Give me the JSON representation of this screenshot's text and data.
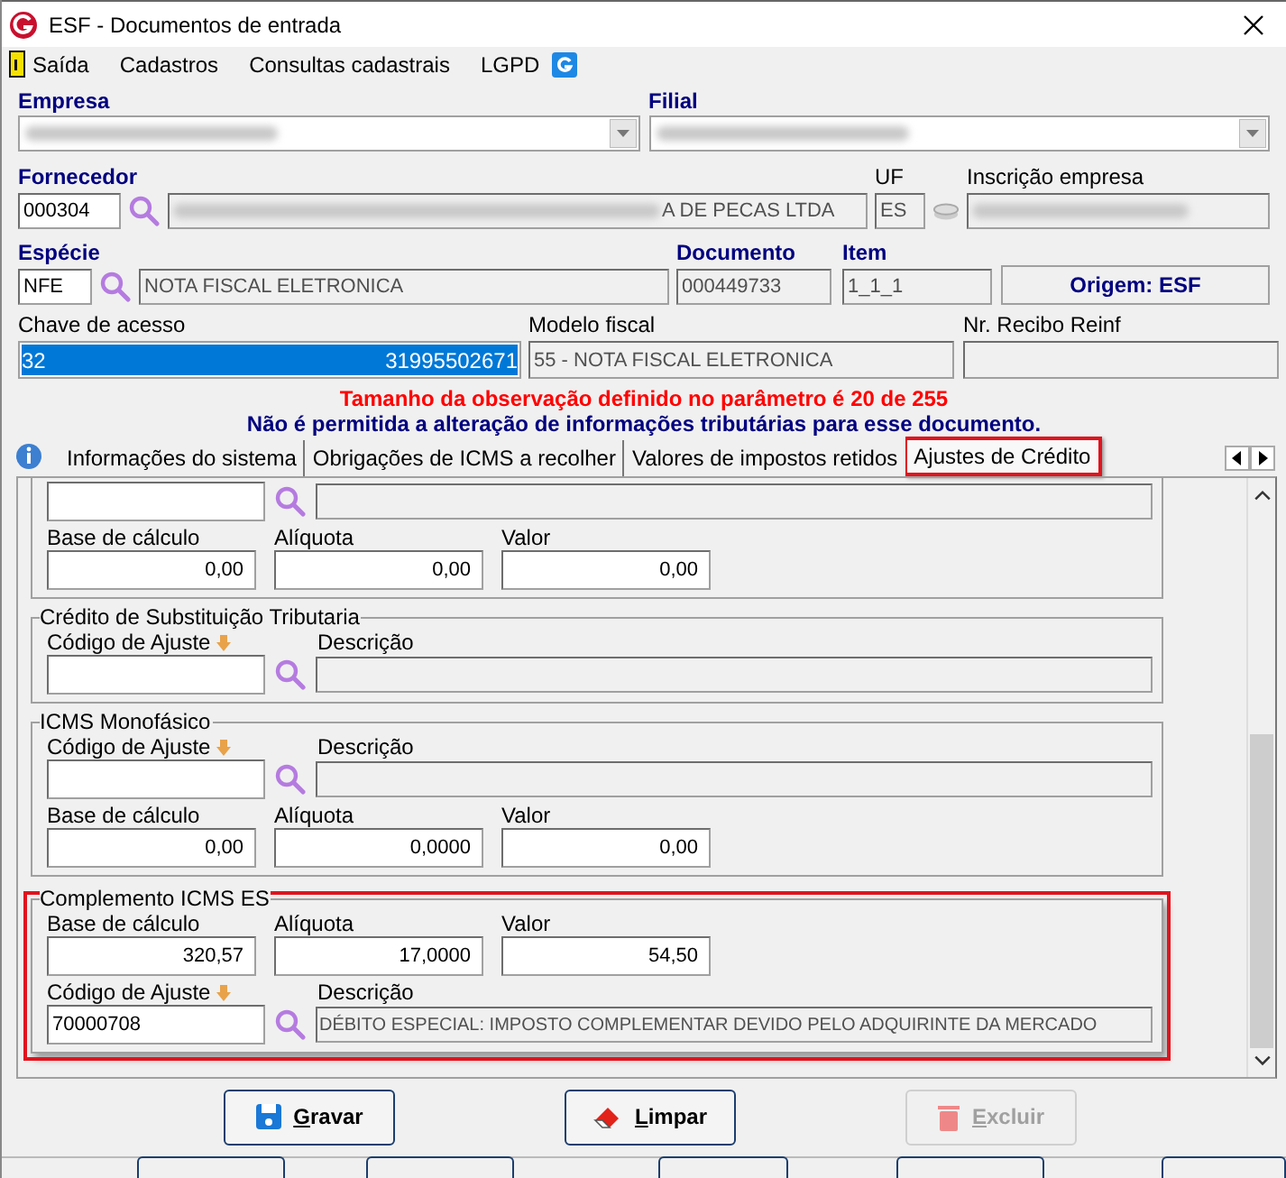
{
  "window": {
    "title": "ESF - Documentos de entrada"
  },
  "menu": [
    "Saída",
    "Cadastros",
    "Consultas cadastrais",
    "LGPD"
  ],
  "header": {
    "empresa": {
      "label": "Empresa"
    },
    "filial": {
      "label": "Filial"
    },
    "fornecedor": {
      "label": "Fornecedor",
      "code": "000304",
      "name_visible": "A DE PECAS LTDA"
    },
    "uf": {
      "label": "UF",
      "value": "ES"
    },
    "inscricao": {
      "label": "Inscrição empresa"
    },
    "especie": {
      "label": "Espécie",
      "code": "NFE",
      "name": "NOTA FISCAL ELETRONICA"
    },
    "documento": {
      "label": "Documento",
      "value": "000449733"
    },
    "item": {
      "label": "Item",
      "value": "1_1_1"
    },
    "origem": "Origem: ESF",
    "chave": {
      "label": "Chave de acesso",
      "start": "32",
      "end": "31995502671"
    },
    "modelo": {
      "label": "Modelo fiscal",
      "value": "55 - NOTA FISCAL ELETRONICA"
    },
    "recibo": {
      "label": "Nr. Recibo Reinf"
    }
  },
  "warnings": [
    {
      "kind": "error",
      "text": "Tamanho da observação definido no parâmetro é 20 de 255"
    },
    {
      "kind": "info",
      "text": "Não é permitida a alteração de informações tributárias para esse documento."
    }
  ],
  "tabs": [
    {
      "label": "Informações do sistema",
      "selected": false,
      "highlighted": false
    },
    {
      "label": "Obrigações de ICMS a recolher",
      "selected": false,
      "highlighted": false
    },
    {
      "label": "Valores de impostos retidos",
      "selected": false,
      "highlighted": false
    },
    {
      "label": "Ajustes de Crédito",
      "selected": true,
      "highlighted": true
    }
  ],
  "sections": [
    {
      "highlighted": false,
      "rows": [
        {
          "kind": "code",
          "code": "",
          "description": ""
        },
        {
          "kind": "values",
          "fields": [
            {
              "label": "Base de cálculo",
              "value": "0,00"
            },
            {
              "label": "Alíquota",
              "value": "0,00"
            },
            {
              "label": "Valor",
              "value": "0,00"
            }
          ]
        }
      ]
    },
    {
      "title": "Crédito de Substituição Tributaria",
      "highlighted": false,
      "rows": [
        {
          "kind": "code",
          "code_label": "Código de Ajuste",
          "description_label": "Descrição",
          "code": "",
          "description": ""
        }
      ]
    },
    {
      "title": "ICMS Monofásico",
      "highlighted": false,
      "rows": [
        {
          "kind": "code",
          "code_label": "Código de Ajuste",
          "description_label": "Descrição",
          "code": "",
          "description": ""
        },
        {
          "kind": "values",
          "fields": [
            {
              "label": "Base de cálculo",
              "value": "0,00"
            },
            {
              "label": "Alíquota",
              "value": "0,0000"
            },
            {
              "label": "Valor",
              "value": "0,00"
            }
          ]
        }
      ]
    },
    {
      "title": "Complemento ICMS ES",
      "highlighted": true,
      "rows": [
        {
          "kind": "values",
          "fields": [
            {
              "label": "Base de cálculo",
              "value": "320,57"
            },
            {
              "label": "Alíquota",
              "value": "17,0000"
            },
            {
              "label": "Valor",
              "value": "54,50"
            }
          ]
        },
        {
          "kind": "code",
          "code_label": "Código de Ajuste",
          "description_label": "Descrição",
          "code": "70000708",
          "description": "DÉBITO ESPECIAL: IMPOSTO COMPLEMENTAR DEVIDO PELO ADQUIRINTE DA MERCADO"
        }
      ]
    }
  ],
  "buttons": [
    {
      "kind": "save",
      "label": "Gravar",
      "disabled": false
    },
    {
      "kind": "clear",
      "label": "Limpar",
      "disabled": false
    },
    {
      "kind": "delete",
      "label": "Excluir",
      "disabled": true
    }
  ]
}
